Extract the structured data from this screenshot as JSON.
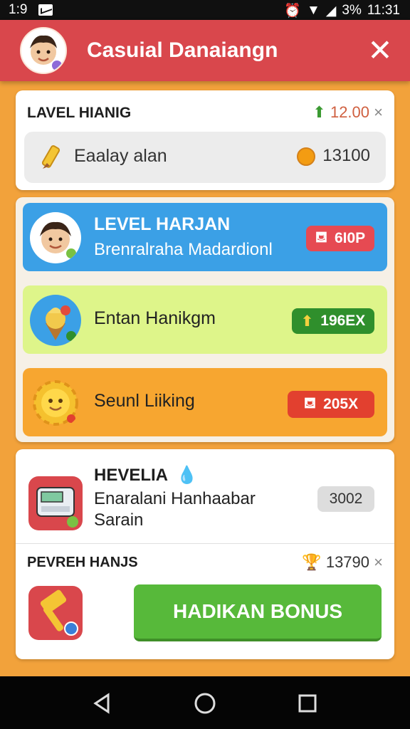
{
  "statusbar": {
    "left_time": "1:9",
    "battery": "3%",
    "clock": "11:31"
  },
  "header": {
    "title": "Casuial Danaiangn",
    "close_symbol": "✕"
  },
  "card1": {
    "title": "LAVEL HIANIG",
    "value": "12.00",
    "x_mark": "×",
    "inner_label": "Eaalay alan",
    "inner_value": "13100"
  },
  "levels": [
    {
      "name": "LEVEL HARJAN",
      "sub": "Brenralraha Madardionl",
      "pill": "6I0P",
      "bg": "#3ba0e6",
      "pill_color": "#e64a52"
    },
    {
      "name": "Entan Hanikgm",
      "pill": "196EX",
      "bg": "#def58a",
      "pill_color": "#2f8f2c"
    },
    {
      "name": "Seunl Liiking",
      "pill": "205X",
      "bg": "#f7a630",
      "pill_color": "#e2402f"
    }
  ],
  "card3": {
    "title": "HEVELIA",
    "line1": "Enaralani Hanhaabar",
    "line2": "Sarain",
    "badge": "3002",
    "footer_title": "PEVREH HANJS",
    "footer_value": "13790",
    "x_mark": "×",
    "button": "HADIKAN BONUS",
    "button_color": "#57b93a"
  },
  "colors": {
    "header": "#d9474c",
    "background": "#f2a23b"
  }
}
